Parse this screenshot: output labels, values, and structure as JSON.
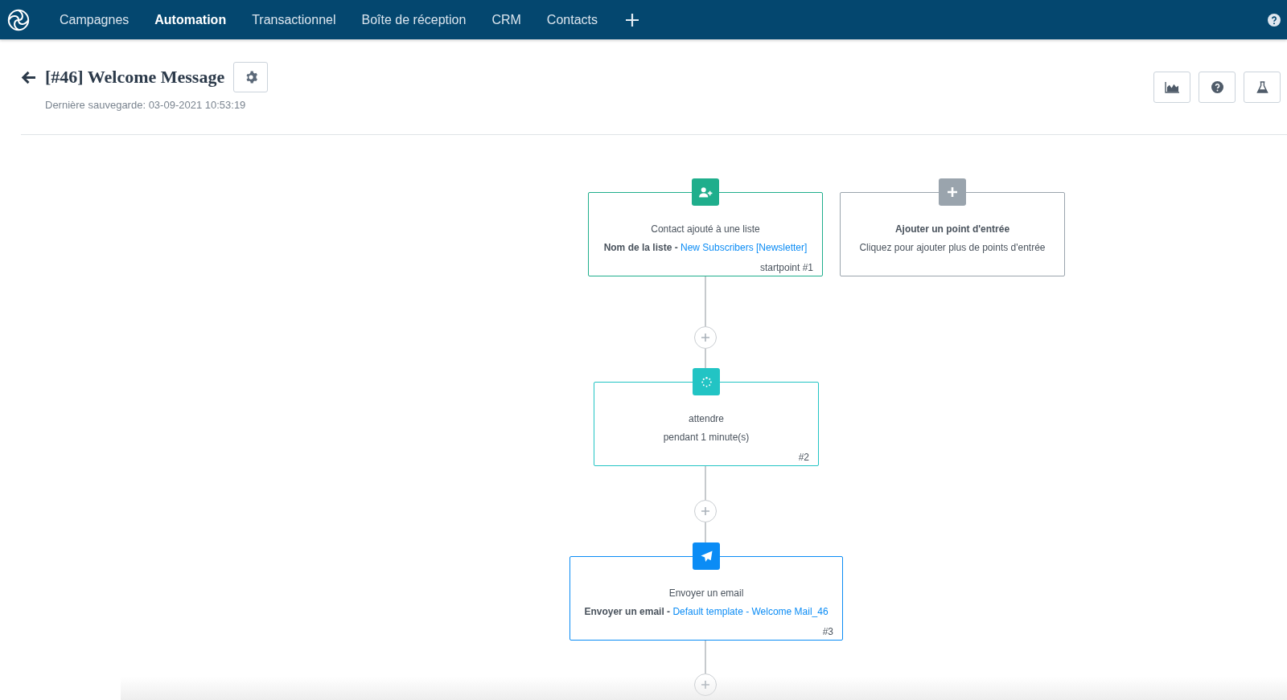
{
  "nav": {
    "items": [
      {
        "label": "Campagnes",
        "selected": false
      },
      {
        "label": "Automation",
        "selected": true
      },
      {
        "label": "Transactionnel",
        "selected": false
      },
      {
        "label": "Boîte de réception",
        "selected": false
      },
      {
        "label": "CRM",
        "selected": false
      },
      {
        "label": "Contacts",
        "selected": false
      }
    ]
  },
  "header": {
    "title": "[#46] Welcome Message",
    "last_saved": "Dernière sauvegarde: 03-09-2021 10:53:19"
  },
  "nodes": [
    {
      "kind": "trigger",
      "color": "#1fae8c",
      "title": "Contact ajouté à une liste",
      "detail_label": "Nom de la liste - ",
      "detail_link": "New Subscribers [Newsletter]",
      "footer": "startpoint #1"
    },
    {
      "kind": "add-entry",
      "color": "#9aa4ad",
      "title": "Ajouter un point d'entrée",
      "detail": "Cliquez pour ajouter plus de points d'entrée"
    },
    {
      "kind": "wait",
      "color": "#22c4c4",
      "title": "attendre",
      "detail": "pendant 1 minute(s)",
      "footer": "#2"
    },
    {
      "kind": "email",
      "color": "#0b8cf5",
      "title": "Envoyer un email",
      "detail_label": "Envoyer un email - ",
      "detail_link": "Default template - Welcome Mail_46",
      "footer": "#3"
    }
  ]
}
